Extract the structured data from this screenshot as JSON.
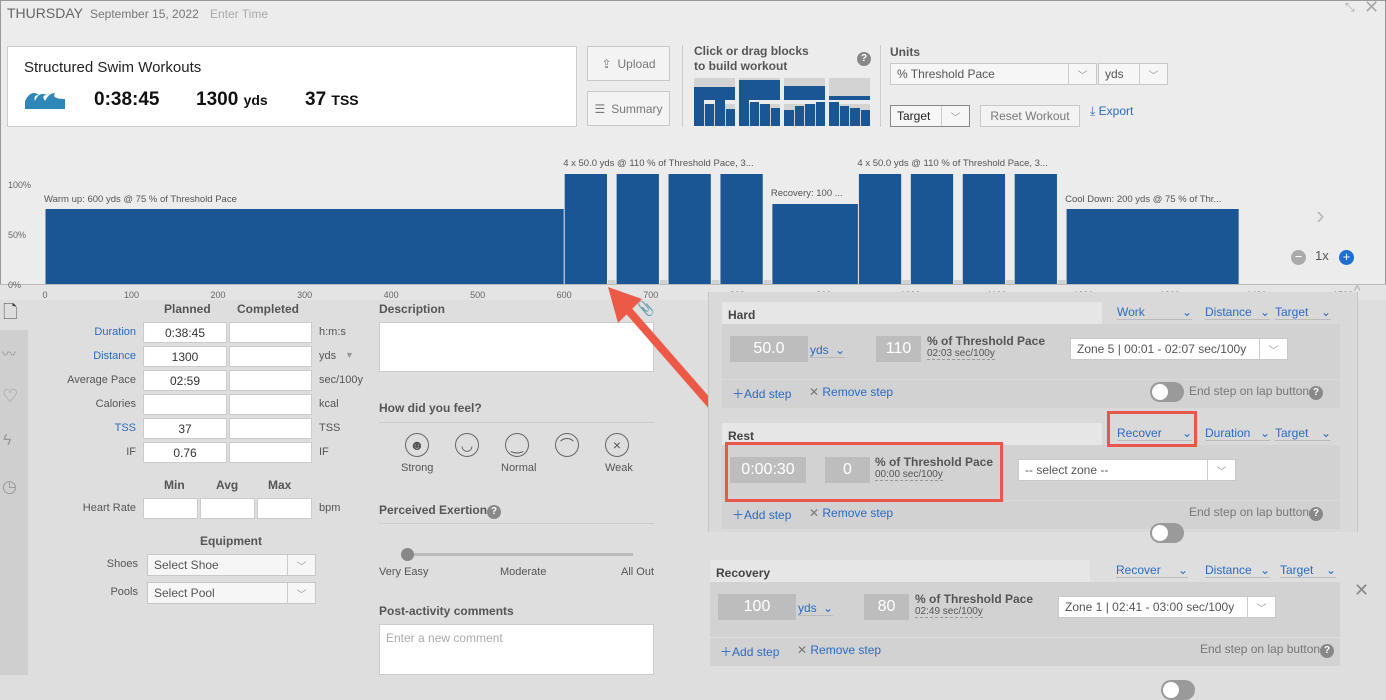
{
  "header": {
    "day": "THURSDAY",
    "date": "September 15, 2022",
    "enter_time": "Enter Time"
  },
  "summary": {
    "title": "Structured Swim Workouts",
    "duration": "0:38:45",
    "distance": "1300",
    "distance_unit": "yds",
    "tss": "37",
    "tss_unit": "TSS"
  },
  "buttons": {
    "upload": "Upload",
    "summary": "Summary",
    "reset": "Reset Workout",
    "export": "Export"
  },
  "builder": {
    "hint": "Click or drag blocks to build workout"
  },
  "units": {
    "label": "Units",
    "pace": "% Threshold Pace",
    "distance": "yds",
    "target": "Target"
  },
  "chart_data": {
    "type": "bar",
    "xlim": [
      0,
      1500
    ],
    "ylim": [
      0,
      110
    ],
    "xticks": [
      "0",
      "100",
      "200",
      "300",
      "400",
      "500",
      "600",
      "700",
      "800",
      "900",
      "1000",
      "1100",
      "1200",
      "1300",
      "1400",
      "1500"
    ],
    "yticks": [
      "100%",
      "50%",
      "0%"
    ],
    "segments": [
      {
        "start": 0,
        "end": 600,
        "value": 75
      },
      {
        "start": 600,
        "end": 650,
        "value": 110
      },
      {
        "start": 650,
        "end": 660,
        "value": 0
      },
      {
        "start": 660,
        "end": 710,
        "value": 110
      },
      {
        "start": 710,
        "end": 720,
        "value": 0
      },
      {
        "start": 720,
        "end": 770,
        "value": 110
      },
      {
        "start": 770,
        "end": 780,
        "value": 0
      },
      {
        "start": 780,
        "end": 830,
        "value": 110
      },
      {
        "start": 830,
        "end": 840,
        "value": 0
      },
      {
        "start": 840,
        "end": 940,
        "value": 80
      },
      {
        "start": 940,
        "end": 990,
        "value": 110
      },
      {
        "start": 990,
        "end": 1000,
        "value": 0
      },
      {
        "start": 1000,
        "end": 1050,
        "value": 110
      },
      {
        "start": 1050,
        "end": 1060,
        "value": 0
      },
      {
        "start": 1060,
        "end": 1110,
        "value": 110
      },
      {
        "start": 1110,
        "end": 1120,
        "value": 0
      },
      {
        "start": 1120,
        "end": 1170,
        "value": 110
      },
      {
        "start": 1170,
        "end": 1180,
        "value": 0
      },
      {
        "start": 1180,
        "end": 1380,
        "value": 75
      }
    ],
    "annotations": [
      "Warm up: 600 yds @ 75 % of Threshold Pace",
      "4 x 50.0 yds @ 110 % of Threshold Pace, 3...",
      "Recovery: 100 ...",
      "4 x 50.0 yds @ 110 % of Threshold Pace, 3...",
      "Cool Down: 200 yds @ 75 % of Thr..."
    ],
    "zoom": "1x",
    "bar_color": "#1b5694"
  },
  "stats": {
    "planned": "Planned",
    "completed": "Completed",
    "rows": [
      {
        "label": "Duration",
        "planned": "0:38:45",
        "unit": "h:m:s"
      },
      {
        "label": "Distance",
        "planned": "1300",
        "unit": "yds"
      },
      {
        "label": "Average Pace",
        "planned": "02:59",
        "unit": "sec/100y"
      },
      {
        "label": "Calories",
        "planned": "",
        "unit": "kcal"
      },
      {
        "label": "TSS",
        "planned": "37",
        "unit": "TSS"
      },
      {
        "label": "IF",
        "planned": "0.76",
        "unit": "IF"
      }
    ],
    "hr": {
      "min": "Min",
      "avg": "Avg",
      "max": "Max",
      "label": "Heart Rate",
      "unit": "bpm"
    },
    "equipment": "Equipment",
    "shoes": "Shoes",
    "shoes_value": "Select Shoe",
    "pools": "Pools",
    "pools_value": "Select Pool"
  },
  "feel": {
    "description": "Description",
    "how": "How did you feel?",
    "strong": "Strong",
    "normal": "Normal",
    "weak": "Weak",
    "exertion": "Perceived Exertion",
    "very_easy": "Very Easy",
    "moderate": "Moderate",
    "all_out": "All Out",
    "comments": "Post-activity comments",
    "comment_placeholder": "Enter a new comment"
  },
  "steps": [
    {
      "name": "Hard",
      "type": "Work",
      "mode": "Distance",
      "target": "Target",
      "amount": "50.0",
      "unit": "yds",
      "pct": "110",
      "pct_label": "% of Threshold Pace",
      "pace": "02:03 sec/100y",
      "zone": "Zone 5 | 00:01 - 02:07 sec/100y"
    },
    {
      "name": "Rest",
      "type": "Recover",
      "mode": "Duration",
      "target": "Target",
      "amount": "0:00:30",
      "pct": "0",
      "pct_label": "% of Threshold Pace",
      "pace": "00:00 sec/100y",
      "zone": "-- select zone --"
    },
    {
      "name": "Recovery",
      "type": "Recover",
      "mode": "Distance",
      "target": "Target",
      "amount": "100",
      "unit": "yds",
      "pct": "80",
      "pct_label": "% of Threshold Pace",
      "pace": "02:49 sec/100y",
      "zone": "Zone 1 | 02:41 - 03:00 sec/100y"
    }
  ],
  "step_actions": {
    "add": "Add step",
    "remove": "Remove step",
    "lap": "End step on lap button"
  }
}
